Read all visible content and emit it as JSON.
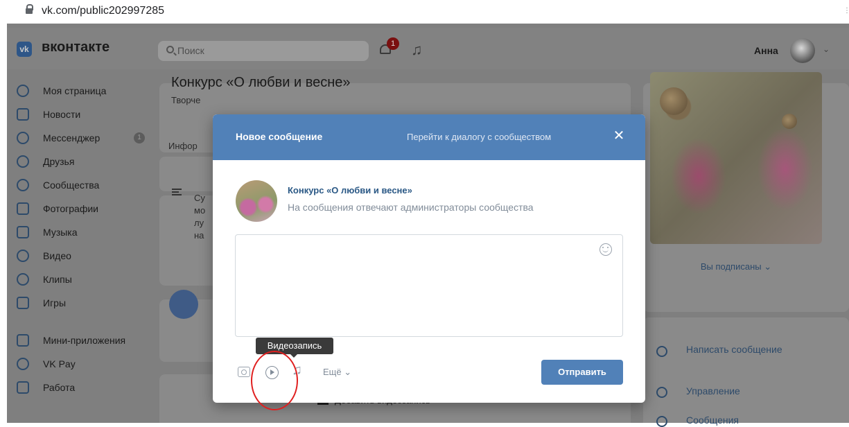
{
  "browser": {
    "url": "vk.com/public202997285"
  },
  "header": {
    "logo_badge": "vk",
    "logo_text": "вконтакте",
    "search_placeholder": "Поиск",
    "notifications_count": "1",
    "user_name": "Анна"
  },
  "nav": {
    "items": [
      {
        "label": "Моя страница",
        "icon": "user-circle-icon"
      },
      {
        "label": "Новости",
        "icon": "news-icon"
      },
      {
        "label": "Мессенджер",
        "icon": "chat-bubble-icon",
        "badge": "1"
      },
      {
        "label": "Друзья",
        "icon": "friends-icon"
      },
      {
        "label": "Сообщества",
        "icon": "communities-icon"
      },
      {
        "label": "Фотографии",
        "icon": "photo-icon"
      },
      {
        "label": "Музыка",
        "icon": "music-icon"
      },
      {
        "label": "Видео",
        "icon": "video-icon"
      },
      {
        "label": "Клипы",
        "icon": "clips-icon"
      },
      {
        "label": "Игры",
        "icon": "gamepad-icon"
      }
    ],
    "items2": [
      {
        "label": "Мини-приложения",
        "icon": "apps-icon"
      },
      {
        "label": "VK Pay",
        "icon": "vkpay-icon"
      },
      {
        "label": "Работа",
        "icon": "briefcase-icon"
      }
    ]
  },
  "group": {
    "title": "Конкурс «О любви и весне»",
    "subtitle_partial": "Творче",
    "info_tab_partial": "Инфор",
    "desc_lines": [
      "Су",
      "мо",
      "лу",
      "на"
    ],
    "add_video": "Добавить видеозапись"
  },
  "right": {
    "subscribed_label": "Вы подписаны",
    "write_message": "Написать сообщение",
    "manage": "Управление",
    "messages_partial": "Сообщения"
  },
  "modal": {
    "title": "Новое сообщение",
    "go_to_dialog": "Перейти к диалогу с сообществом",
    "community_name": "Конкурс «О любви и весне»",
    "community_note": "На сообщения отвечают администраторы сообщества",
    "message_value": "",
    "tooltip": "Видеозапись",
    "more_label": "Ещё",
    "send_label": "Отправить"
  },
  "colors": {
    "vk_blue": "#5181b8",
    "link_blue": "#2a5885",
    "annotation_red": "#e02020"
  }
}
